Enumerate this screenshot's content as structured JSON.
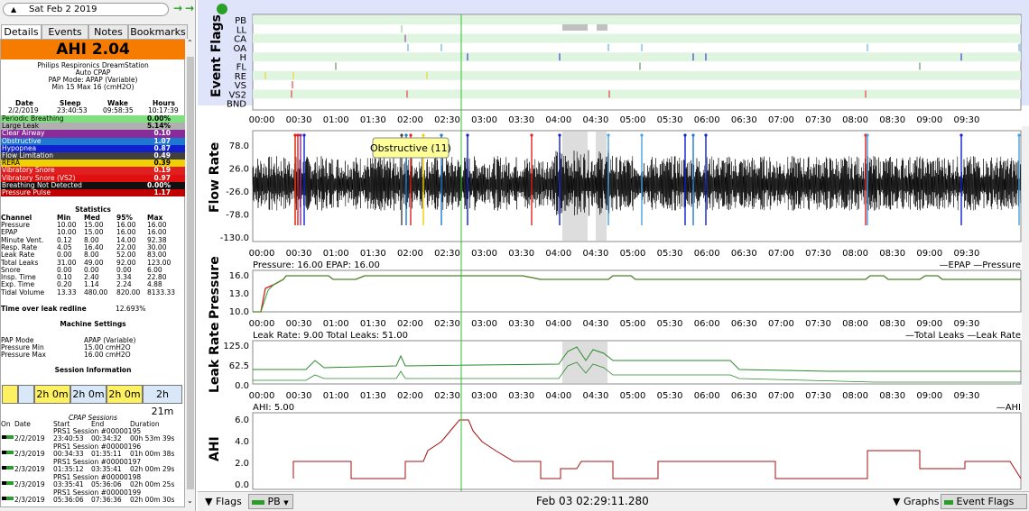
{
  "nav": {
    "date": "Sat Feb 2 2019",
    "prev_icon": "up-arrow-icon",
    "back": "→",
    "fwd": "→|"
  },
  "tabs": [
    "Details",
    "Events",
    "Notes",
    "Bookmarks"
  ],
  "ahi_label": "AHI 2.04",
  "machine": {
    "line1": "Philips Respironics DreamStation",
    "line2": "Auto CPAP",
    "line3": "PAP Mode: APAP (Variable)",
    "line4": "Min 15 Max 16 (cmH2O)"
  },
  "session_hdr": {
    "date": "Date",
    "sleep": "Sleep",
    "wake": "Wake",
    "hours": "Hours"
  },
  "session_vals": {
    "date": "2/2/2019",
    "sleep": "23:40:53",
    "wake": "09:58:35",
    "hours": "10:17:39"
  },
  "events": [
    {
      "name": "Periodic Breathing",
      "value": "0.00%",
      "color": "#80e080",
      "fg": "#000"
    },
    {
      "name": "Large Leak",
      "value": "5.14%",
      "color": "#b0b0b0",
      "fg": "#000"
    },
    {
      "name": "Clear Airway",
      "value": "0.10",
      "color": "#8a2b9a",
      "fg": "#fff"
    },
    {
      "name": "Obstructive",
      "value": "1.07",
      "color": "#1e78d0",
      "fg": "#fff"
    },
    {
      "name": "Hypopnea",
      "value": "0.87",
      "color": "#1020d0",
      "fg": "#fff"
    },
    {
      "name": "Flow Limitation",
      "value": "0.49",
      "color": "#404040",
      "fg": "#fff"
    },
    {
      "name": "RERA",
      "value": "0.39",
      "color": "#f0d000",
      "fg": "#000"
    },
    {
      "name": "Vibratory Snore",
      "value": "0.19",
      "color": "#e02020",
      "fg": "#fff"
    },
    {
      "name": "Vibratory Snore (VS2)",
      "value": "0.97",
      "color": "#e01010",
      "fg": "#fff"
    },
    {
      "name": "Breathing Not Detected",
      "value": "0.00%",
      "color": "#101010",
      "fg": "#fff"
    },
    {
      "name": "Pressure Pulse",
      "value": "1.17",
      "color": "#c00000",
      "fg": "#fff"
    }
  ],
  "stats": {
    "title": "Statistics",
    "headers": [
      "Channel",
      "Min",
      "Med",
      "95%",
      "Max"
    ],
    "rows": [
      [
        "Pressure",
        "10.00",
        "15.00",
        "16.00",
        "16.00"
      ],
      [
        "EPAP",
        "10.00",
        "15.00",
        "16.00",
        "16.00"
      ],
      [
        "Minute Vent.",
        "0.12",
        "8.00",
        "14.00",
        "92.38"
      ],
      [
        "Resp. Rate",
        "4.05",
        "16.40",
        "22.00",
        "30.00"
      ],
      [
        "Leak Rate",
        "0.00",
        "8.00",
        "52.00",
        "83.00"
      ],
      [
        "Total Leaks",
        "31.00",
        "49.00",
        "92.00",
        "123.00"
      ],
      [
        "Snore",
        "0.00",
        "0.00",
        "0.00",
        "6.00"
      ],
      [
        "Insp. Time",
        "0.10",
        "2.40",
        "3.34",
        "22.80"
      ],
      [
        "Exp. Time",
        "0.20",
        "1.14",
        "2.24",
        "4.88"
      ],
      [
        "Tidal Volume",
        "13.33",
        "480.00",
        "820.00",
        "8133.33"
      ]
    ],
    "redline_label": "Time over leak redline",
    "redline_value": "12.693%"
  },
  "settings": {
    "title": "Machine Settings",
    "rows": [
      [
        "PAP Mode",
        "APAP (Variable)"
      ],
      [
        "Pressure Min",
        "15.00 cmH2O"
      ],
      [
        "Pressure Max",
        "16.00 cmH2O"
      ]
    ]
  },
  "session_info": {
    "title": "Session Information",
    "blocks": [
      "2h 0m",
      "2h 0m",
      "2h 0m",
      "2h 21m"
    ]
  },
  "cpap": {
    "title": "CPAP Sessions",
    "headers": [
      "On",
      "Date",
      "Start",
      "End",
      "Duration"
    ],
    "rows": [
      {
        "label": "PRS1 Session #00000195",
        "date": "2/2/2019",
        "start": "23:40:53",
        "end": "00:34:32",
        "dur": "00h 53m 39s"
      },
      {
        "label": "PRS1 Session #00000196",
        "date": "2/3/2019",
        "start": "00:34:33",
        "end": "01:35:11",
        "dur": "01h 00m 38s"
      },
      {
        "label": "PRS1 Session #00000197",
        "date": "2/3/2019",
        "start": "01:35:12",
        "end": "03:35:41",
        "dur": "02h 00m 29s"
      },
      {
        "label": "PRS1 Session #00000198",
        "date": "2/3/2019",
        "start": "03:35:41",
        "end": "05:36:06",
        "dur": "02h 00m 25s"
      },
      {
        "label": "PRS1 Session #00000199",
        "date": "2/3/2019",
        "start": "05:36:06",
        "end": "07:36:36",
        "dur": "02h 00m 30s"
      }
    ]
  },
  "graphs": {
    "time_ticks": [
      "00:00",
      "00:30",
      "01:00",
      "01:30",
      "02:00",
      "02:30",
      "03:00",
      "03:30",
      "04:00",
      "04:30",
      "05:00",
      "05:30",
      "06:00",
      "06:30",
      "07:00",
      "07:30",
      "08:00",
      "08:30",
      "09:00",
      "09:30"
    ],
    "event_flags": {
      "title": "Event Flags",
      "channels": [
        "PB",
        "LL",
        "CA",
        "OA",
        "H",
        "FL",
        "RE",
        "VS",
        "VS2",
        "BND"
      ]
    },
    "flow": {
      "title": "Flow Rate",
      "yticks": [
        "78.0",
        "26.0",
        "-26.0",
        "-78.0",
        "-130.0"
      ],
      "tooltip": "Obstructive (11)"
    },
    "pressure": {
      "title": "Pressure",
      "header": "Pressure: 16.00 EPAP: 16.00",
      "yticks": [
        "16.0",
        "13.0",
        "10.0"
      ],
      "legend": [
        "EPAP",
        "Pressure"
      ]
    },
    "leak": {
      "title": "Leak Rate",
      "header": "Leak Rate: 9.00 Total Leaks: 51.00",
      "yticks": [
        "125.0",
        "62.5",
        "0.0"
      ],
      "legend": [
        "Total Leaks",
        "Leak Rate"
      ]
    },
    "ahi": {
      "title": "AHI",
      "header": "AHI: 5.00",
      "yticks": [
        "6.0",
        "4.0",
        "2.0",
        "0.0"
      ],
      "legend": [
        "AHI"
      ]
    }
  },
  "bottom": {
    "flags": "Flags",
    "pb": "PB",
    "time": "Feb 03 02:29:11.280",
    "graphs": "Graphs",
    "event_flags": "Event Flags"
  }
}
